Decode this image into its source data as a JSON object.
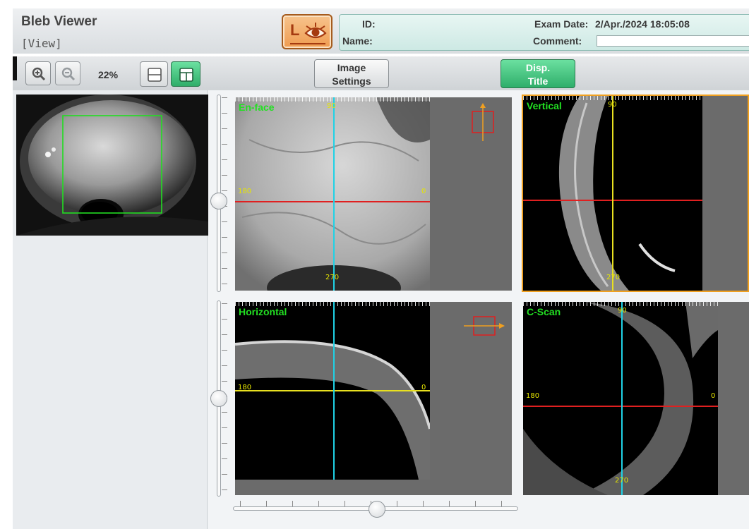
{
  "header": {
    "title": "Bleb Viewer",
    "mode": "[View]",
    "eye_side": "L",
    "id_label": "ID:",
    "name_label": "Name:",
    "exam_date_label": "Exam Date:",
    "exam_date_value": "2/Apr./2024 18:05:08",
    "comment_label": "Comment:"
  },
  "toolbar": {
    "zoom_in_icon": "zoom-in-icon",
    "zoom_out_icon": "zoom-out-icon",
    "zoom_value": "22%",
    "layout_single_icon": "layout-rows-icon",
    "layout_quad_icon": "layout-grid-icon",
    "image_settings_line1": "Image",
    "image_settings_line2": "Settings",
    "disp_title_line1": "Disp.",
    "disp_title_line2": "Title"
  },
  "views": {
    "enface": {
      "title": "En-face",
      "deg_top": "90",
      "deg_left": "180",
      "deg_right": "0",
      "deg_bottom": "270"
    },
    "vertical": {
      "title": "Vertical",
      "deg_top": "90",
      "deg_bottom": "270"
    },
    "horizontal": {
      "title": "Horizontal",
      "deg_left": "180",
      "deg_right": "0"
    },
    "cscan": {
      "title": "C-Scan",
      "deg_top": "90",
      "deg_left": "180",
      "deg_right": "0",
      "deg_bottom": "270"
    }
  },
  "colors": {
    "title_green": "#22e022",
    "cursor_cyan": "#1fd2e6",
    "cursor_red": "#e02020",
    "cursor_yellow": "#e8e020",
    "roi_green": "#22dd22",
    "selected_border": "#f0a020"
  }
}
